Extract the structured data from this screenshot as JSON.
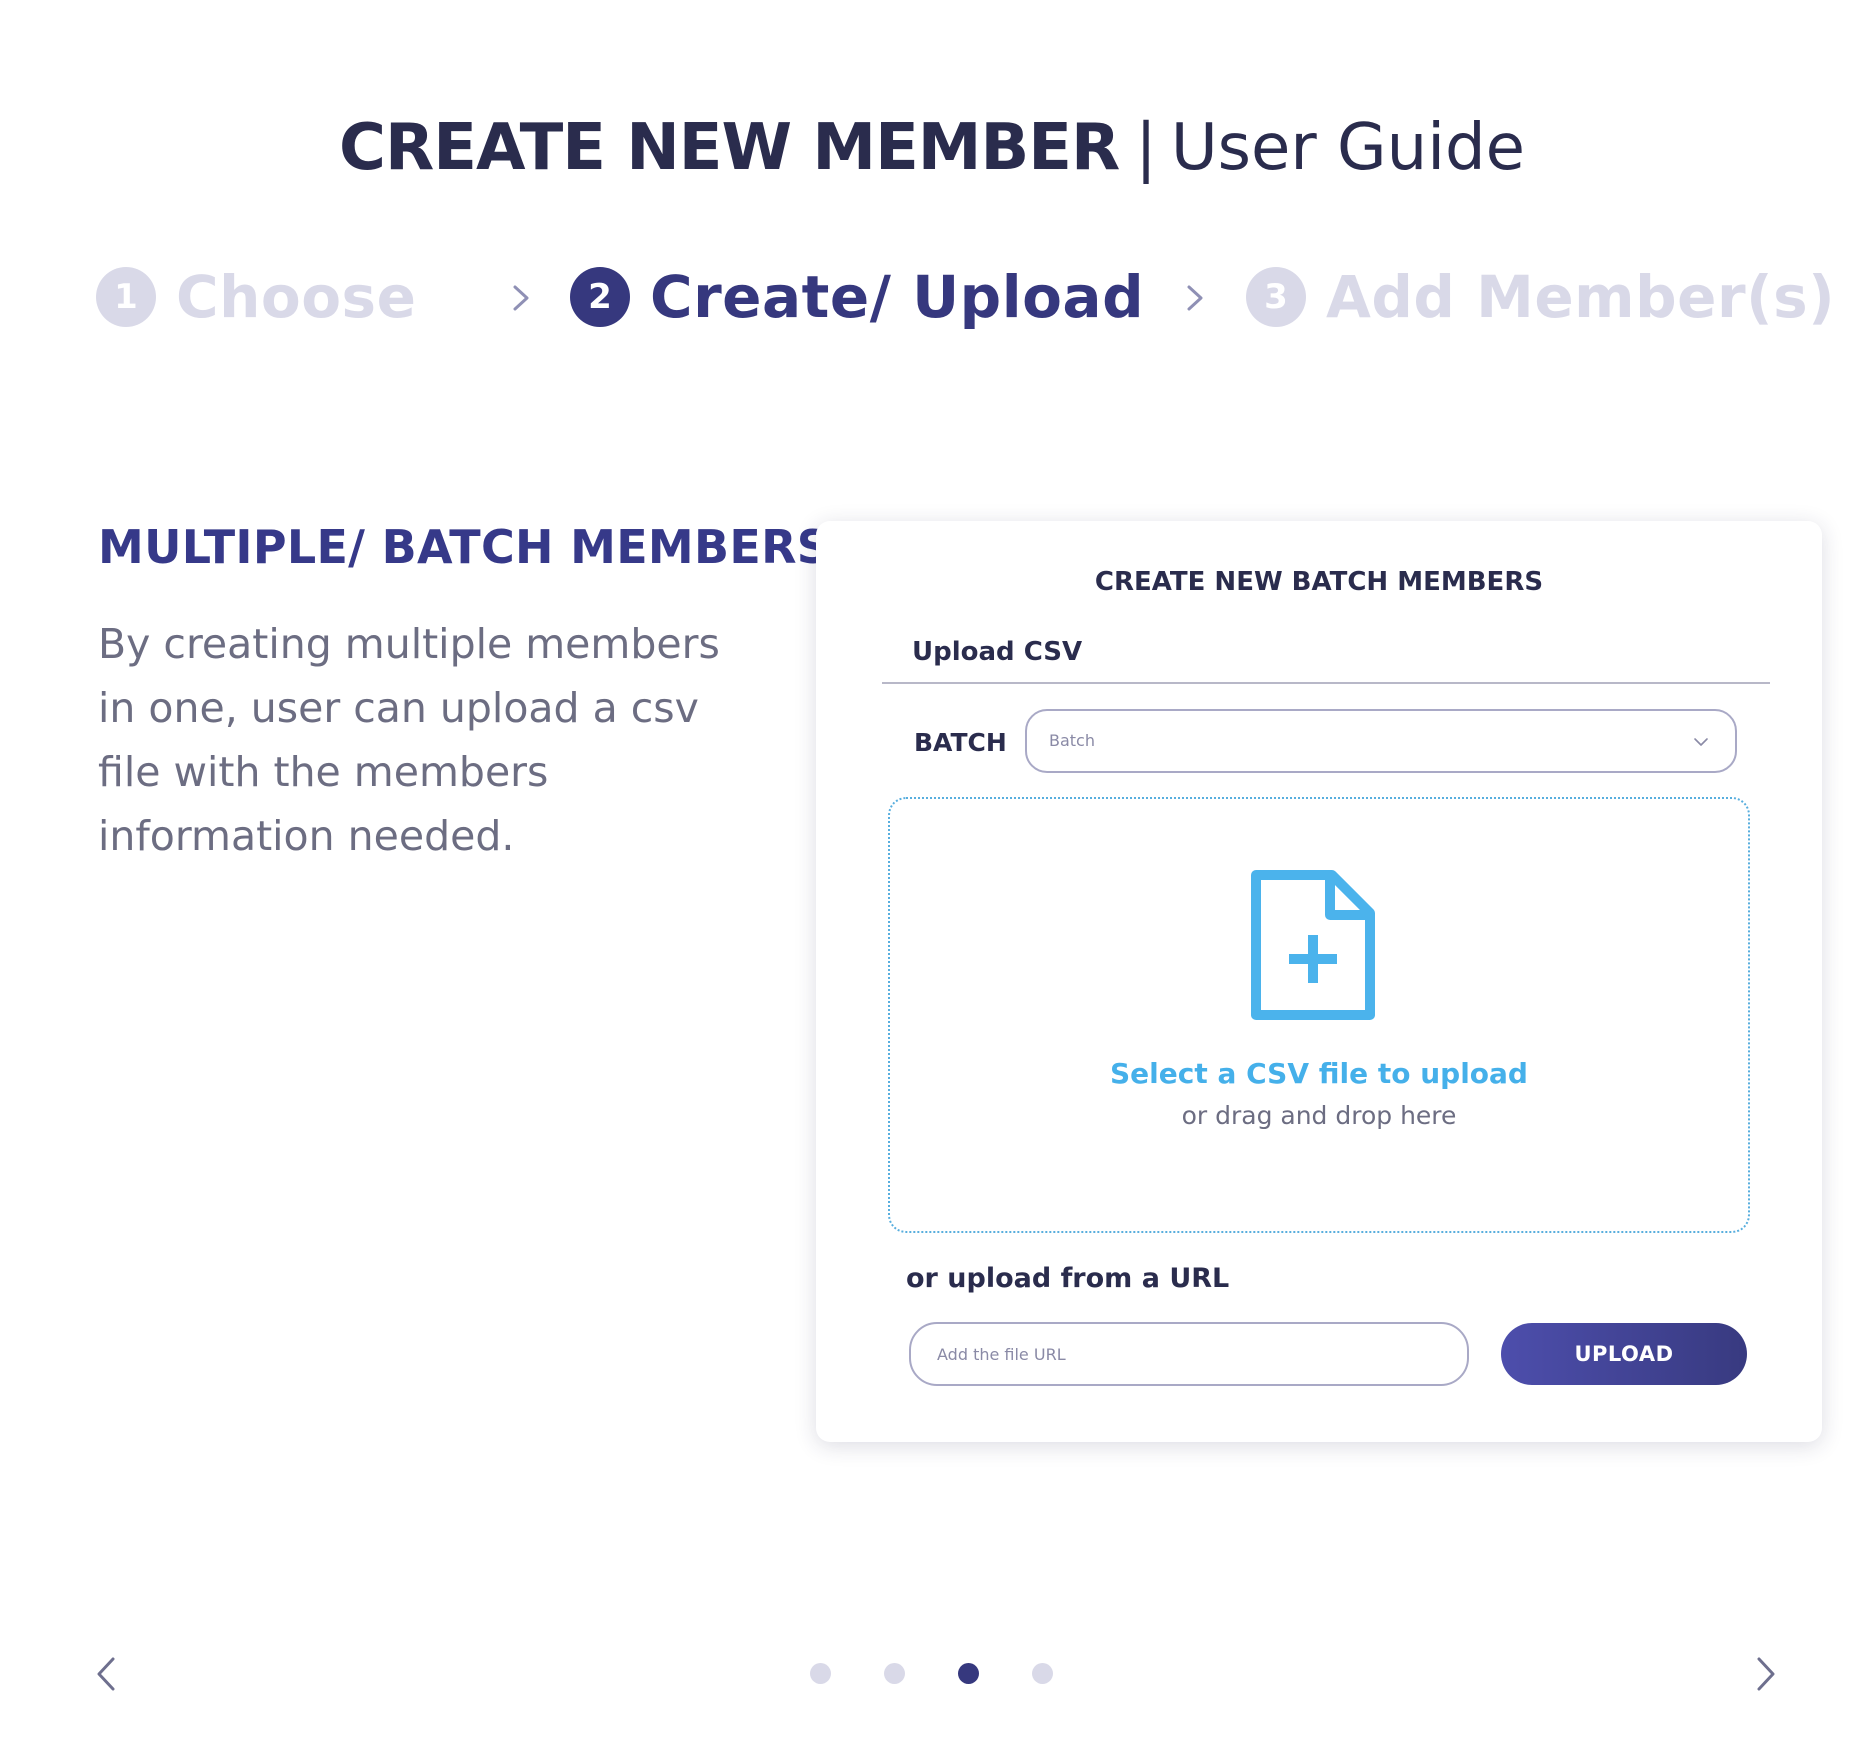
{
  "header": {
    "title_bold": "CREATE NEW MEMBER",
    "separator": "|",
    "title_light": "User Guide"
  },
  "stepper": {
    "steps": [
      {
        "number": "1",
        "label": "Choose",
        "state": "inactive"
      },
      {
        "number": "2",
        "label": "Create/ Upload",
        "state": "active"
      },
      {
        "number": "3",
        "label": "Add Member(s)",
        "state": "inactive"
      }
    ]
  },
  "section": {
    "heading": "MULTIPLE/ BATCH  MEMBERS",
    "body": "By creating multiple members in one, user can upload a csv file with the members information needed."
  },
  "card": {
    "title": "CREATE  NEW BATCH MEMBERS",
    "tab_label": "Upload CSV",
    "batch_label": "BATCH",
    "batch_select_value": "Batch",
    "dropzone": {
      "title": "Select a CSV file to upload",
      "subtitle": "or drag and drop here"
    },
    "url_label": "or upload from a URL",
    "url_placeholder": "Add the file URL",
    "upload_button": "UPLOAD"
  },
  "carousel": {
    "page_count": 4,
    "active_page": 3
  },
  "icons": {
    "step_chevron": "chevron-right-icon",
    "select_chevron": "chevron-down-icon",
    "file_add": "file-add-icon",
    "prev": "chevron-left-icon",
    "next": "chevron-right-icon"
  },
  "colors": {
    "primary": "#36387e",
    "inactive": "#d9d9e8",
    "accent_blue": "#45b0ea",
    "text_dark": "#2a2c4d",
    "text_muted": "#6c6d82"
  }
}
